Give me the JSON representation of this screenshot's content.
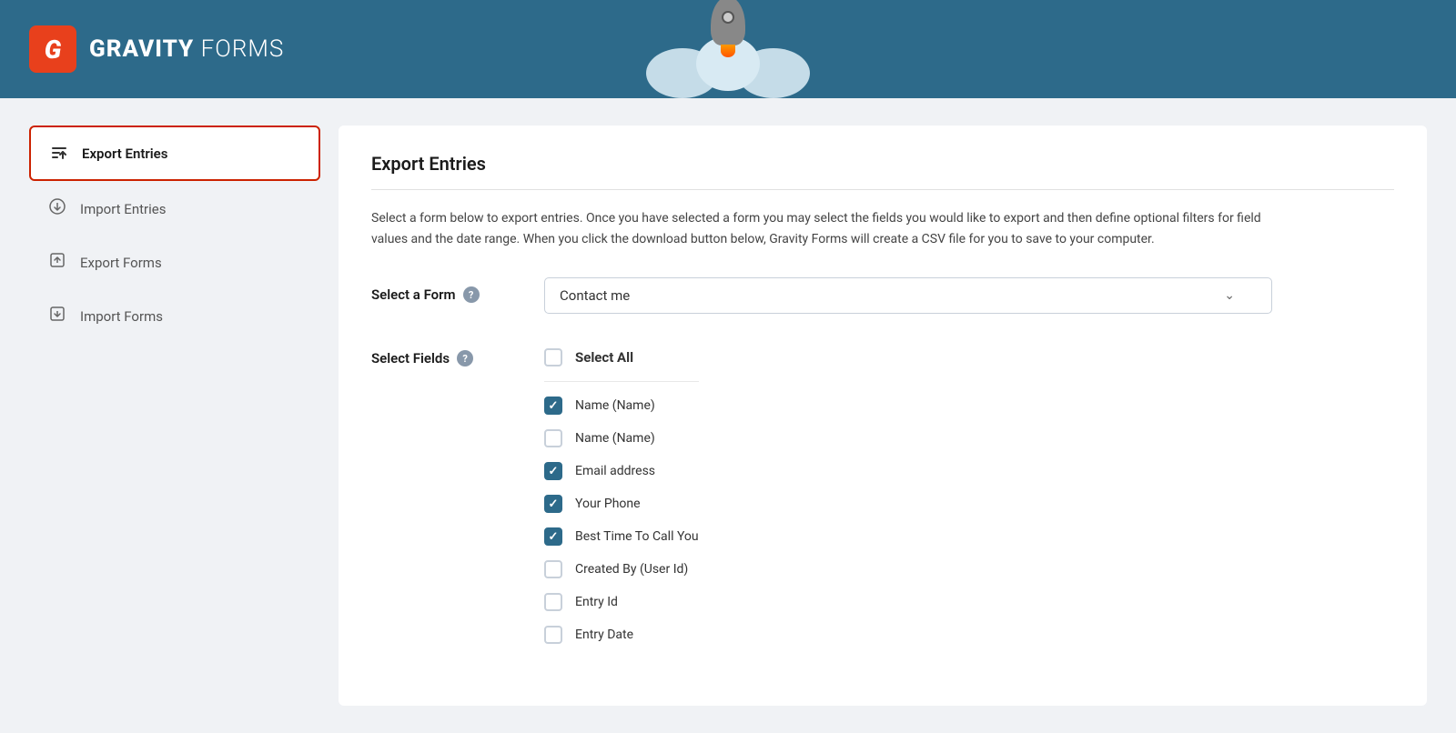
{
  "header": {
    "logo_letter": "G",
    "logo_bold": "GRAVITY",
    "logo_light": " FORMS"
  },
  "sidebar": {
    "items": [
      {
        "id": "export-entries",
        "label": "Export Entries",
        "icon": "⬆",
        "active": true
      },
      {
        "id": "import-entries",
        "label": "Import Entries",
        "icon": "⊙"
      },
      {
        "id": "export-forms",
        "label": "Export Forms",
        "icon": "⬆"
      },
      {
        "id": "import-forms",
        "label": "Import Forms",
        "icon": "⬇"
      }
    ]
  },
  "content": {
    "title": "Export Entries",
    "description": "Select a form below to export entries. Once you have selected a form you may select the fields you would like to export and then define optional filters for field values and the date range. When you click the download button below, Gravity Forms will create a CSV file for you to save to your computer.",
    "select_form_label": "Select a Form",
    "select_fields_label": "Select Fields",
    "selected_form": "Contact me",
    "help_tooltip": "?",
    "fields": [
      {
        "id": "select-all",
        "label": "Select All",
        "checked": false,
        "bold": true
      },
      {
        "id": "name-1",
        "label": "Name (Name)",
        "checked": true
      },
      {
        "id": "name-2",
        "label": "Name (Name)",
        "checked": false
      },
      {
        "id": "email",
        "label": "Email address",
        "checked": true
      },
      {
        "id": "phone",
        "label": "Your Phone",
        "checked": true
      },
      {
        "id": "best-time",
        "label": "Best Time To Call You",
        "checked": true
      },
      {
        "id": "created-by",
        "label": "Created By (User Id)",
        "checked": false
      },
      {
        "id": "entry-id",
        "label": "Entry Id",
        "checked": false
      },
      {
        "id": "entry-date",
        "label": "Entry Date",
        "checked": false
      }
    ]
  }
}
